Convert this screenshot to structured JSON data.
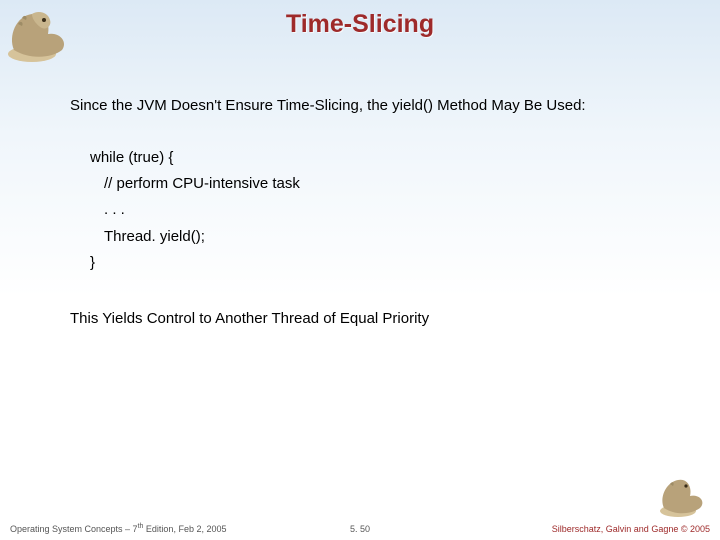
{
  "title": "Time-Slicing",
  "para1": "Since the JVM Doesn't Ensure Time-Slicing, the yield() Method May Be Used:",
  "code": {
    "l0": "while (true) {",
    "l1": "// perform CPU-intensive task",
    "l2": ". . .",
    "l3": "Thread. yield();",
    "l4": "}"
  },
  "para2": "This Yields Control to Another Thread of Equal Priority",
  "footer": {
    "left_a": "Operating System Concepts – 7",
    "left_sup": "th",
    "left_b": " Edition, Feb 2, 2005",
    "center": "5. 50",
    "right": "Silberschatz, Galvin and Gagne © 2005"
  },
  "icons": {
    "dino": "dinosaur-mascot"
  },
  "colors": {
    "accent": "#9e2a2a"
  }
}
